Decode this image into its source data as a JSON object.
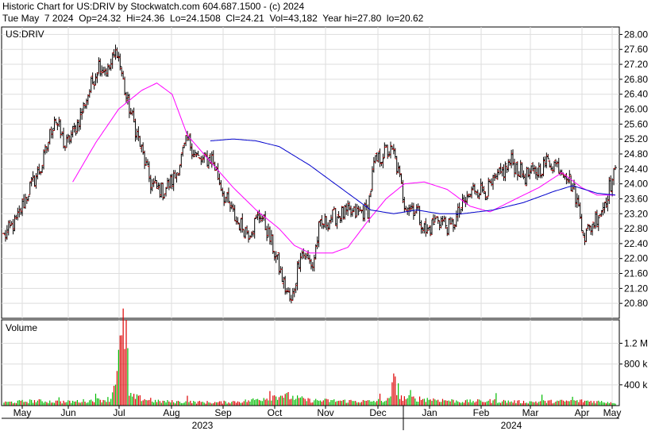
{
  "header": {
    "line1": "Historic Chart for US:DRIV by Stockwatch.com 604.687.1500 - (c) 2024",
    "line2": "Tue May  7 2024  Op=24.32  Hi=24.36  Lo=24.1508  Cl=24.21  Vol=43,182  Year hi=27.80  lo=20.62"
  },
  "chart_data": {
    "type": "ohlc",
    "symbol_label": "US:DRIV",
    "volume_label": "Volume",
    "price_axis": {
      "ylim": [
        20.4,
        28.2
      ],
      "ticks": [
        "28.00",
        "27.60",
        "27.20",
        "26.80",
        "26.40",
        "26.00",
        "25.60",
        "25.20",
        "24.80",
        "24.40",
        "24.00",
        "23.60",
        "23.20",
        "22.80",
        "22.40",
        "22.00",
        "21.60",
        "21.20",
        "20.80"
      ]
    },
    "volume_axis": {
      "ylim": [
        0,
        1650000
      ],
      "ticks": [
        "1.2 M",
        "800 k",
        "400 k"
      ],
      "tick_values": [
        1200000,
        800000,
        400000
      ]
    },
    "months": [
      "May",
      "Jun",
      "Jul",
      "Aug",
      "Sep",
      "Oct",
      "Nov",
      "Dec",
      "Jan",
      "Feb",
      "Mar",
      "Apr",
      "May"
    ],
    "years": [
      "2023",
      "2024"
    ],
    "price_anchors": [
      [
        0,
        22.6
      ],
      [
        8,
        23.0
      ],
      [
        17,
        23.9
      ],
      [
        25,
        24.5
      ],
      [
        33,
        25.8
      ],
      [
        40,
        25.0
      ],
      [
        48,
        25.6
      ],
      [
        55,
        26.4
      ],
      [
        62,
        27.2
      ],
      [
        68,
        27.0
      ],
      [
        74,
        27.6
      ],
      [
        80,
        26.3
      ],
      [
        88,
        25.2
      ],
      [
        96,
        24.0
      ],
      [
        104,
        23.8
      ],
      [
        112,
        24.2
      ],
      [
        120,
        25.2
      ],
      [
        128,
        24.6
      ],
      [
        136,
        24.7
      ],
      [
        144,
        23.7
      ],
      [
        152,
        23.0
      ],
      [
        160,
        22.7
      ],
      [
        168,
        23.2
      ],
      [
        176,
        22.3
      ],
      [
        184,
        21.2
      ],
      [
        188,
        20.8
      ],
      [
        194,
        22.2
      ],
      [
        202,
        21.8
      ],
      [
        206,
        22.8
      ],
      [
        214,
        23.1
      ],
      [
        222,
        23.2
      ],
      [
        230,
        23.2
      ],
      [
        238,
        23.3
      ],
      [
        242,
        24.5
      ],
      [
        250,
        24.9
      ],
      [
        255,
        24.8
      ],
      [
        258,
        24.3
      ],
      [
        262,
        23.5
      ],
      [
        270,
        23.3
      ],
      [
        276,
        22.7
      ],
      [
        284,
        23.1
      ],
      [
        292,
        22.8
      ],
      [
        300,
        23.4
      ],
      [
        308,
        23.9
      ],
      [
        316,
        23.8
      ],
      [
        324,
        24.2
      ],
      [
        332,
        24.6
      ],
      [
        340,
        24.2
      ],
      [
        348,
        24.3
      ],
      [
        356,
        24.6
      ],
      [
        362,
        24.5
      ],
      [
        368,
        24.3
      ],
      [
        374,
        23.7
      ],
      [
        380,
        22.6
      ],
      [
        386,
        23.0
      ],
      [
        392,
        23.4
      ],
      [
        396,
        23.9
      ],
      [
        400,
        24.3
      ]
    ],
    "volume_anchors": [
      [
        0,
        60000
      ],
      [
        20,
        90000
      ],
      [
        40,
        70000
      ],
      [
        60,
        100000
      ],
      [
        70,
        130000
      ],
      [
        80,
        1650000
      ],
      [
        82,
        180000
      ],
      [
        100,
        80000
      ],
      [
        120,
        70000
      ],
      [
        140,
        60000
      ],
      [
        160,
        90000
      ],
      [
        180,
        200000
      ],
      [
        200,
        100000
      ],
      [
        220,
        90000
      ],
      [
        240,
        80000
      ],
      [
        252,
        110000
      ],
      [
        256,
        560000
      ],
      [
        258,
        150000
      ],
      [
        280,
        120000
      ],
      [
        300,
        80000
      ],
      [
        320,
        90000
      ],
      [
        340,
        70000
      ],
      [
        360,
        80000
      ],
      [
        380,
        90000
      ],
      [
        400,
        60000
      ]
    ],
    "volume_spikes": [
      [
        36,
        160000
      ],
      [
        60,
        230000
      ],
      [
        96,
        150000
      ],
      [
        120,
        190000
      ],
      [
        174,
        280000
      ],
      [
        182,
        190000
      ],
      [
        186,
        260000
      ],
      [
        246,
        230000
      ],
      [
        256,
        560000
      ],
      [
        258,
        430000
      ],
      [
        266,
        300000
      ],
      [
        322,
        240000
      ],
      [
        352,
        210000
      ],
      [
        372,
        170000
      ]
    ],
    "ma_short": {
      "start_index": 45,
      "anchors": [
        [
          45,
          24.05
        ],
        [
          60,
          25.1
        ],
        [
          75,
          26.0
        ],
        [
          90,
          26.5
        ],
        [
          100,
          26.7
        ],
        [
          110,
          26.4
        ],
        [
          120,
          25.3
        ],
        [
          135,
          24.6
        ],
        [
          150,
          23.9
        ],
        [
          165,
          23.3
        ],
        [
          180,
          22.8
        ],
        [
          190,
          22.35
        ],
        [
          200,
          22.15
        ],
        [
          215,
          22.15
        ],
        [
          225,
          22.3
        ],
        [
          238,
          23.0
        ],
        [
          250,
          23.6
        ],
        [
          262,
          24.0
        ],
        [
          275,
          24.05
        ],
        [
          290,
          23.85
        ],
        [
          305,
          23.4
        ],
        [
          318,
          23.25
        ],
        [
          335,
          23.6
        ],
        [
          350,
          23.9
        ],
        [
          365,
          24.3
        ],
        [
          378,
          23.9
        ],
        [
          388,
          23.7
        ],
        [
          400,
          23.7
        ]
      ],
      "color": "#ff00ff"
    },
    "ma_long": {
      "start_index": 135,
      "anchors": [
        [
          135,
          25.15
        ],
        [
          150,
          25.2
        ],
        [
          165,
          25.15
        ],
        [
          180,
          25.0
        ],
        [
          200,
          24.5
        ],
        [
          220,
          23.9
        ],
        [
          240,
          23.3
        ],
        [
          255,
          23.2
        ],
        [
          270,
          23.3
        ],
        [
          285,
          23.2
        ],
        [
          300,
          23.2
        ],
        [
          320,
          23.3
        ],
        [
          340,
          23.5
        ],
        [
          360,
          23.8
        ],
        [
          372,
          23.95
        ],
        [
          388,
          23.75
        ],
        [
          400,
          23.7
        ]
      ],
      "color": "#0000cc"
    }
  }
}
